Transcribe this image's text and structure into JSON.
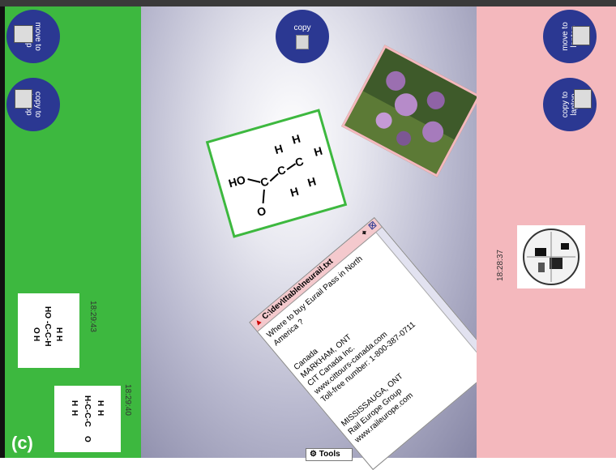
{
  "caption": "(c)",
  "buttons": {
    "left_move": "move to laptop",
    "left_copy": "copy to laptop",
    "center_copy": "copy",
    "right_move": "move to laptop",
    "right_copy": "copy to laptop"
  },
  "timestamps": {
    "left_top": "18:29:43",
    "left_bottom": "18:29:40",
    "right": "18:28:37"
  },
  "window": {
    "title": "C:\\dev\\ttable\\neurail.txt",
    "lines": [
      "Where to buy Eurail Pass in North America ?",
      "",
      "",
      "Canada",
      "MARKHAM, ONT",
      "CIT Canada Inc.",
      "www.cittours-canada.com",
      "Toll-free number: 1-800-387-0711",
      "",
      "",
      "MISSISSAUGA, ONT",
      "Rail Europe Group",
      "www.raileurope.com"
    ]
  },
  "toolbar": {
    "tools_label": "Tools"
  },
  "colors": {
    "left_panel": "#3db83f",
    "right_panel": "#f4b8bd",
    "button_blue": "#2b3892"
  }
}
